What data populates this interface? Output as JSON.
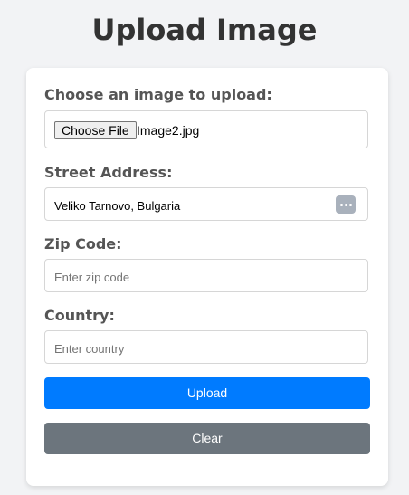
{
  "page": {
    "title": "Upload Image"
  },
  "form": {
    "file": {
      "label": "Choose an image to upload:",
      "button_label": "Choose File",
      "file_name": "Image2.jpg"
    },
    "street": {
      "label": "Street Address:",
      "value": "Veliko Tarnovo, Bulgaria",
      "icon": "autofill-dots-icon"
    },
    "zip": {
      "label": "Zip Code:",
      "placeholder": "Enter zip code",
      "value": ""
    },
    "country": {
      "label": "Country:",
      "placeholder": "Enter country",
      "value": ""
    },
    "upload_label": "Upload",
    "clear_label": "Clear"
  },
  "colors": {
    "primary": "#007bff",
    "secondary": "#6c757d",
    "background": "#f2f3f5",
    "card": "#ffffff",
    "title": "#333333",
    "label": "#555555"
  }
}
